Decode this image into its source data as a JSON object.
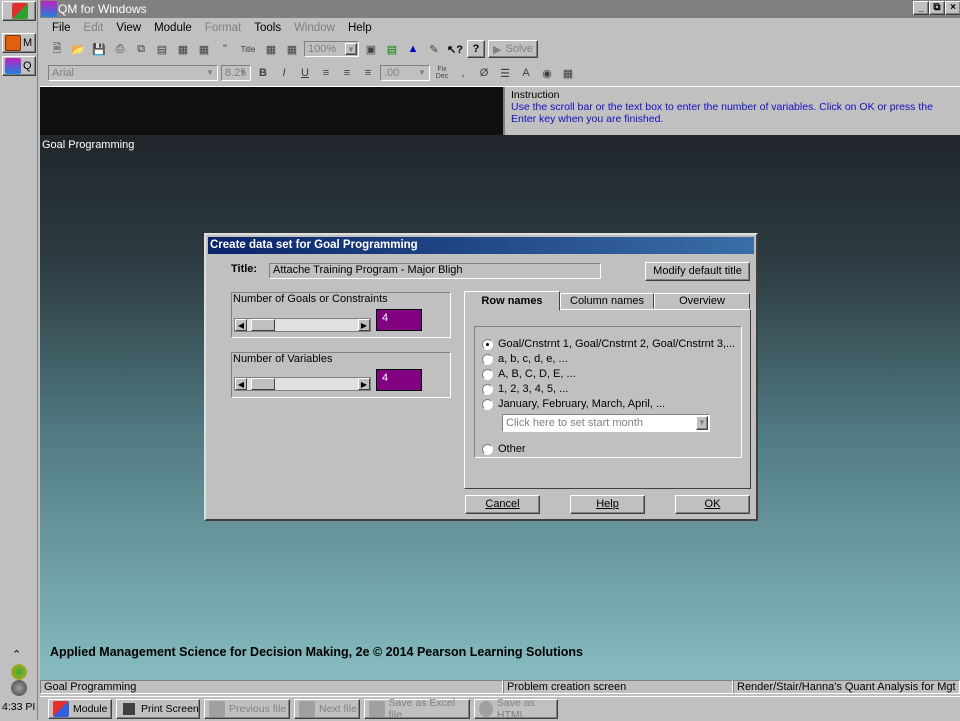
{
  "window": {
    "title": "QM for Windows"
  },
  "leftbar": {
    "items": [
      {
        "label": "M"
      },
      {
        "label": "Q"
      }
    ],
    "clock": "4:33 PI"
  },
  "menu": [
    {
      "label": "File",
      "enabled": true
    },
    {
      "label": "Edit",
      "enabled": false
    },
    {
      "label": "View",
      "enabled": true
    },
    {
      "label": "Module",
      "enabled": true
    },
    {
      "label": "Format",
      "enabled": false
    },
    {
      "label": "Tools",
      "enabled": true
    },
    {
      "label": "Window",
      "enabled": false
    },
    {
      "label": "Help",
      "enabled": true
    }
  ],
  "toolbar": {
    "zoom": "100%",
    "solve": "Solve",
    "font": "Arial",
    "size": "8.25",
    "decimals": ".00",
    "fix_dec_top": "Fix",
    "fix_dec_bot": "Dec",
    "t_title": "Title"
  },
  "instruction": {
    "header": "Instruction",
    "text": "Use the scroll bar or the text box to enter the number of variables. Click on OK or press the Enter key when you are finished."
  },
  "work_label": "Goal Programming",
  "footer_text": "Applied Management Science for Decision Making, 2e © 2014 Pearson Learning Solutions",
  "dialog": {
    "title": "Create data set for Goal Programming",
    "title_label": "Title:",
    "title_value": "Attache Training Program - Major Bligh",
    "modify_button": "Modify default title",
    "goals_label": "Number of Goals or Constraints",
    "goals_value": "4",
    "vars_label": "Number of Variables",
    "vars_value": "4",
    "tabs": [
      {
        "label": "Row names"
      },
      {
        "label": "Column names"
      },
      {
        "label": "Overview"
      }
    ],
    "options": [
      {
        "label": "Goal/Cnstrnt 1, Goal/Cnstrnt 2, Goal/Cnstrnt 3,...",
        "selected": true
      },
      {
        "label": "a, b, c, d, e, ...",
        "selected": false
      },
      {
        "label": "A, B, C, D, E, ...",
        "selected": false
      },
      {
        "label": "1, 2, 3, 4, 5, ...",
        "selected": false
      },
      {
        "label": "January, February, March, April, ...",
        "selected": false
      }
    ],
    "month_placeholder": "Click here to set start month",
    "other_label": "Other",
    "buttons": {
      "cancel": "Cancel",
      "help": "Help",
      "ok": "OK"
    }
  },
  "status": [
    "Goal Programming",
    "Problem creation screen",
    "Render/Stair/Hanna's Quant Analysis for Mgt"
  ],
  "taskbar": [
    {
      "label": "Module",
      "enabled": true
    },
    {
      "label": "Print Screen",
      "enabled": true
    },
    {
      "label": "Previous file",
      "enabled": false
    },
    {
      "label": "Next file",
      "enabled": false
    },
    {
      "label": "Save as Excel file",
      "enabled": false
    },
    {
      "label": "Save as HTML",
      "enabled": false
    }
  ],
  "colors": {
    "accent_title": "#0a246a",
    "value_box": "#800080",
    "instruction_text": "#1010c0"
  }
}
